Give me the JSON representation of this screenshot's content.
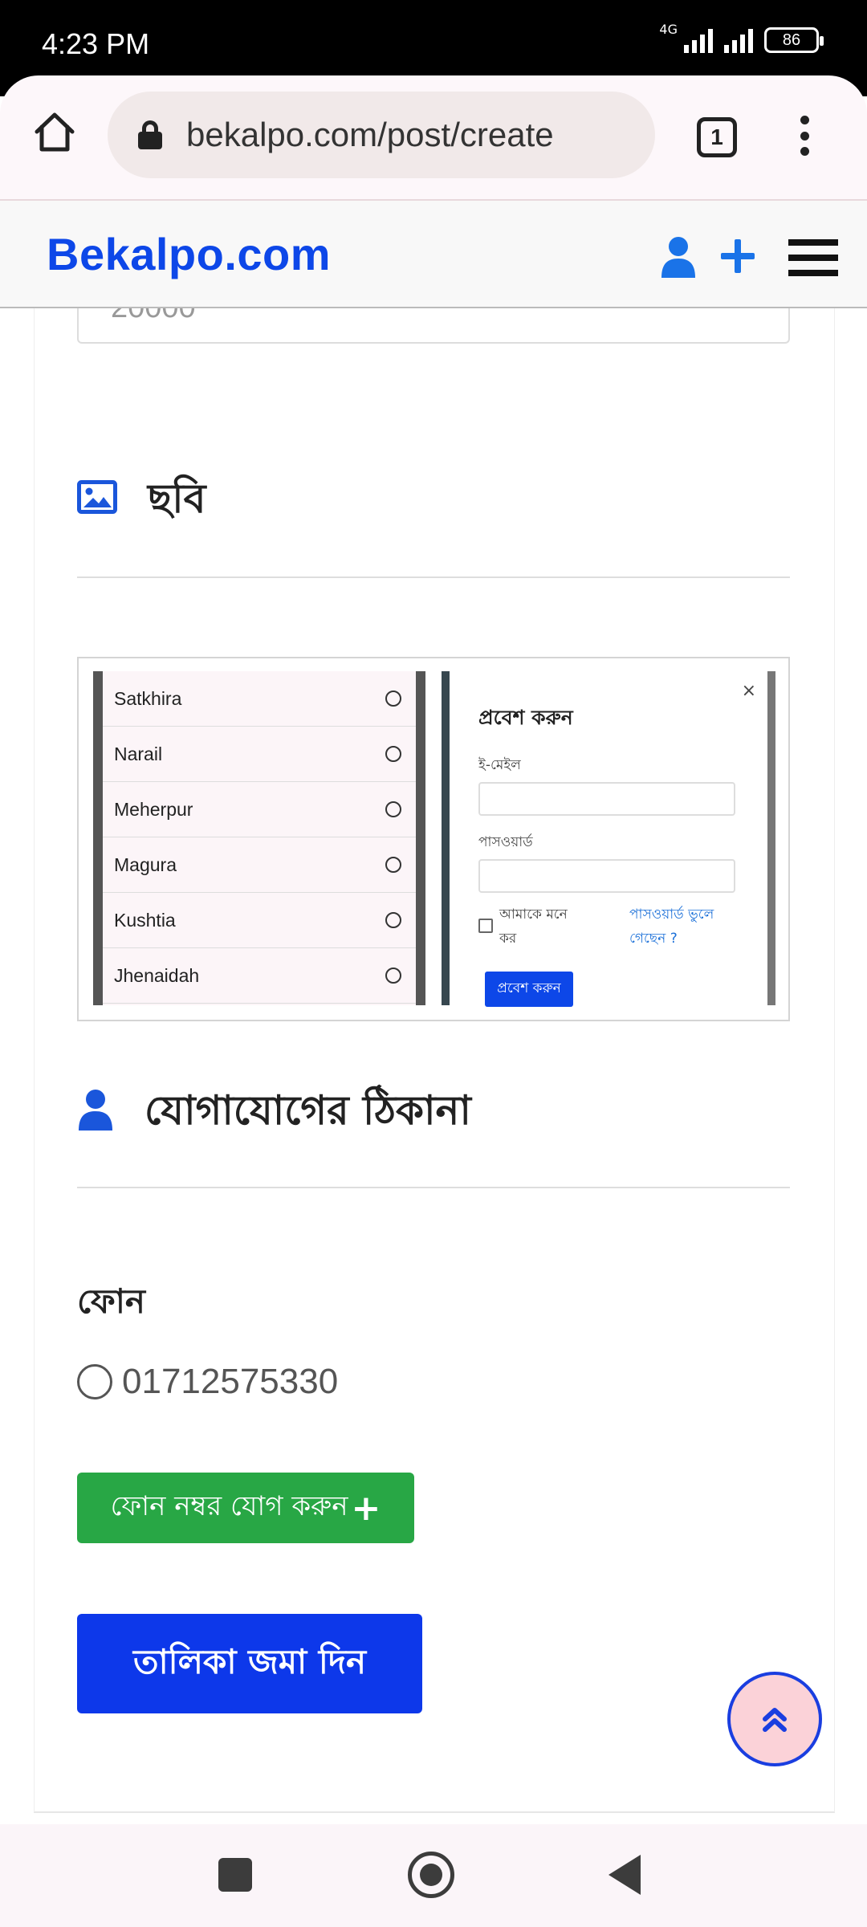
{
  "status_bar": {
    "time": "4:23 PM",
    "network": "4G",
    "battery": "86"
  },
  "browser": {
    "url": "bekalpo.com/post/create",
    "tab_count": "1"
  },
  "site": {
    "logo": "Bekalpo.com"
  },
  "form": {
    "prev_value": "20000",
    "image_section_title": "ছবি",
    "preview": {
      "districts": [
        "Satkhira",
        "Narail",
        "Meherpur",
        "Magura",
        "Kushtia",
        "Jhenaidah"
      ],
      "modal": {
        "close": "×",
        "title": "প্রবেশ করুন",
        "email_label": "ই-মেইল",
        "password_label": "পাসওয়ার্ড",
        "remember": "আমাকে মনে কর",
        "forgot": "পাসওয়ার্ড ভুলে গেছেন ?",
        "submit": "প্রবেশ করুন"
      }
    },
    "contact_section_title": "যোগাযোগের ঠিকানা",
    "phone_label": "ফোন",
    "phone_number": "01712575330",
    "add_phone_button": "ফোন নম্বর যোগ করুন",
    "add_phone_plus": "+",
    "submit_button": "তালিকা জমা দিন"
  },
  "colors": {
    "brand_blue": "#0d47e8",
    "green": "#28a745",
    "submit_blue": "#0d38ea"
  }
}
